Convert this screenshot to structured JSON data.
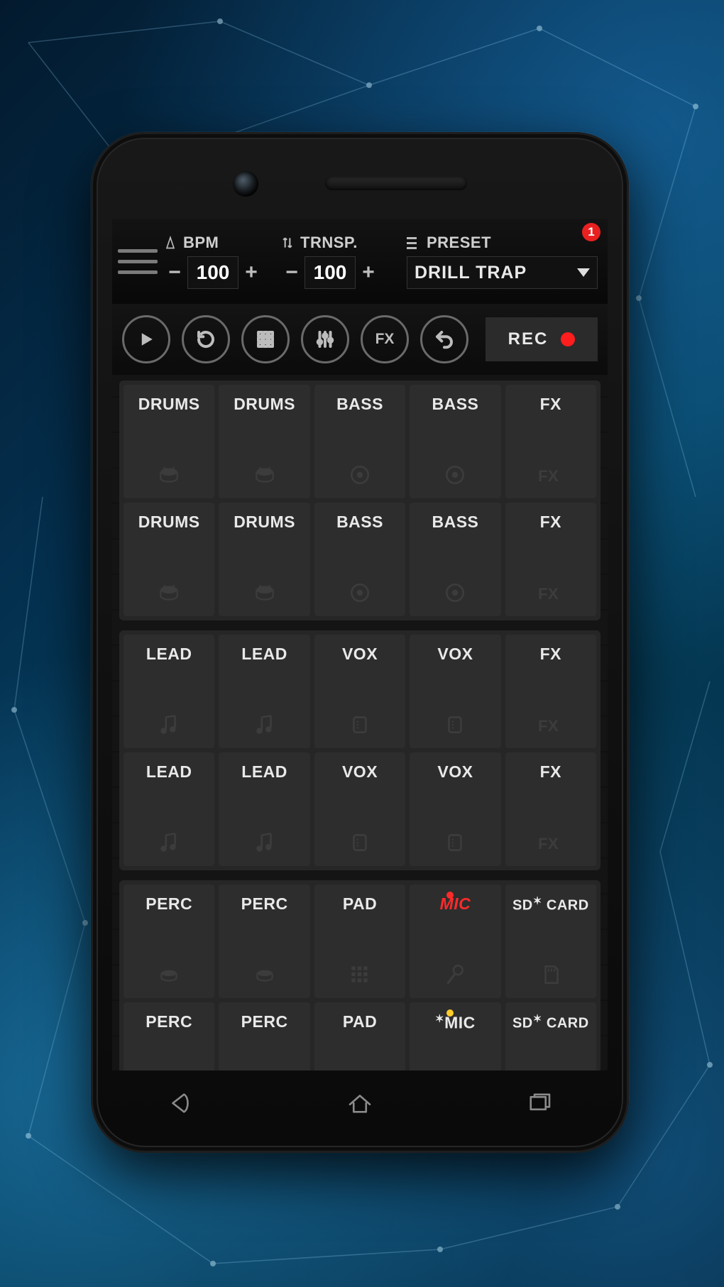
{
  "topbar": {
    "bpm": {
      "label": "BPM",
      "value": "100"
    },
    "transpose": {
      "label": "TRNSP.",
      "value": "100"
    },
    "preset": {
      "label": "PRESET",
      "name": "DRILL TRAP",
      "badge": "1"
    }
  },
  "transport": {
    "fx_label": "FX",
    "rec_label": "REC"
  },
  "pad_blocks": [
    {
      "rows": [
        [
          {
            "label": "DRUMS",
            "icon": "drum"
          },
          {
            "label": "DRUMS",
            "icon": "drum"
          },
          {
            "label": "BASS",
            "icon": "bass"
          },
          {
            "label": "BASS",
            "icon": "bass"
          },
          {
            "label": "FX",
            "icon": "fx"
          }
        ],
        [
          {
            "label": "DRUMS",
            "icon": "drum"
          },
          {
            "label": "DRUMS",
            "icon": "drum"
          },
          {
            "label": "BASS",
            "icon": "bass"
          },
          {
            "label": "BASS",
            "icon": "bass"
          },
          {
            "label": "FX",
            "icon": "fx"
          }
        ]
      ]
    },
    {
      "rows": [
        [
          {
            "label": "LEAD",
            "icon": "note"
          },
          {
            "label": "LEAD",
            "icon": "note"
          },
          {
            "label": "VOX",
            "icon": "vox"
          },
          {
            "label": "VOX",
            "icon": "vox"
          },
          {
            "label": "FX",
            "icon": "fx"
          }
        ],
        [
          {
            "label": "LEAD",
            "icon": "note"
          },
          {
            "label": "LEAD",
            "icon": "note"
          },
          {
            "label": "VOX",
            "icon": "vox"
          },
          {
            "label": "VOX",
            "icon": "vox"
          },
          {
            "label": "FX",
            "icon": "fx"
          }
        ]
      ]
    },
    {
      "rows": [
        [
          {
            "label": "PERC",
            "icon": "perc"
          },
          {
            "label": "PERC",
            "icon": "perc"
          },
          {
            "label": "PAD",
            "icon": "grid"
          },
          {
            "label": "MIC",
            "icon": "mic",
            "style": "red",
            "indicator": "red"
          },
          {
            "label": "SD CARD",
            "icon": "sd",
            "size": "sm",
            "accent": true
          }
        ],
        [
          {
            "label": "PERC",
            "icon": "perc"
          },
          {
            "label": "PERC",
            "icon": "perc"
          },
          {
            "label": "PAD",
            "icon": "grid"
          },
          {
            "label": "MIC",
            "icon": "mic",
            "indicator": "yel",
            "accent": true
          },
          {
            "label": "SD CARD",
            "icon": "sd",
            "size": "sm",
            "accent": true
          }
        ]
      ]
    }
  ]
}
